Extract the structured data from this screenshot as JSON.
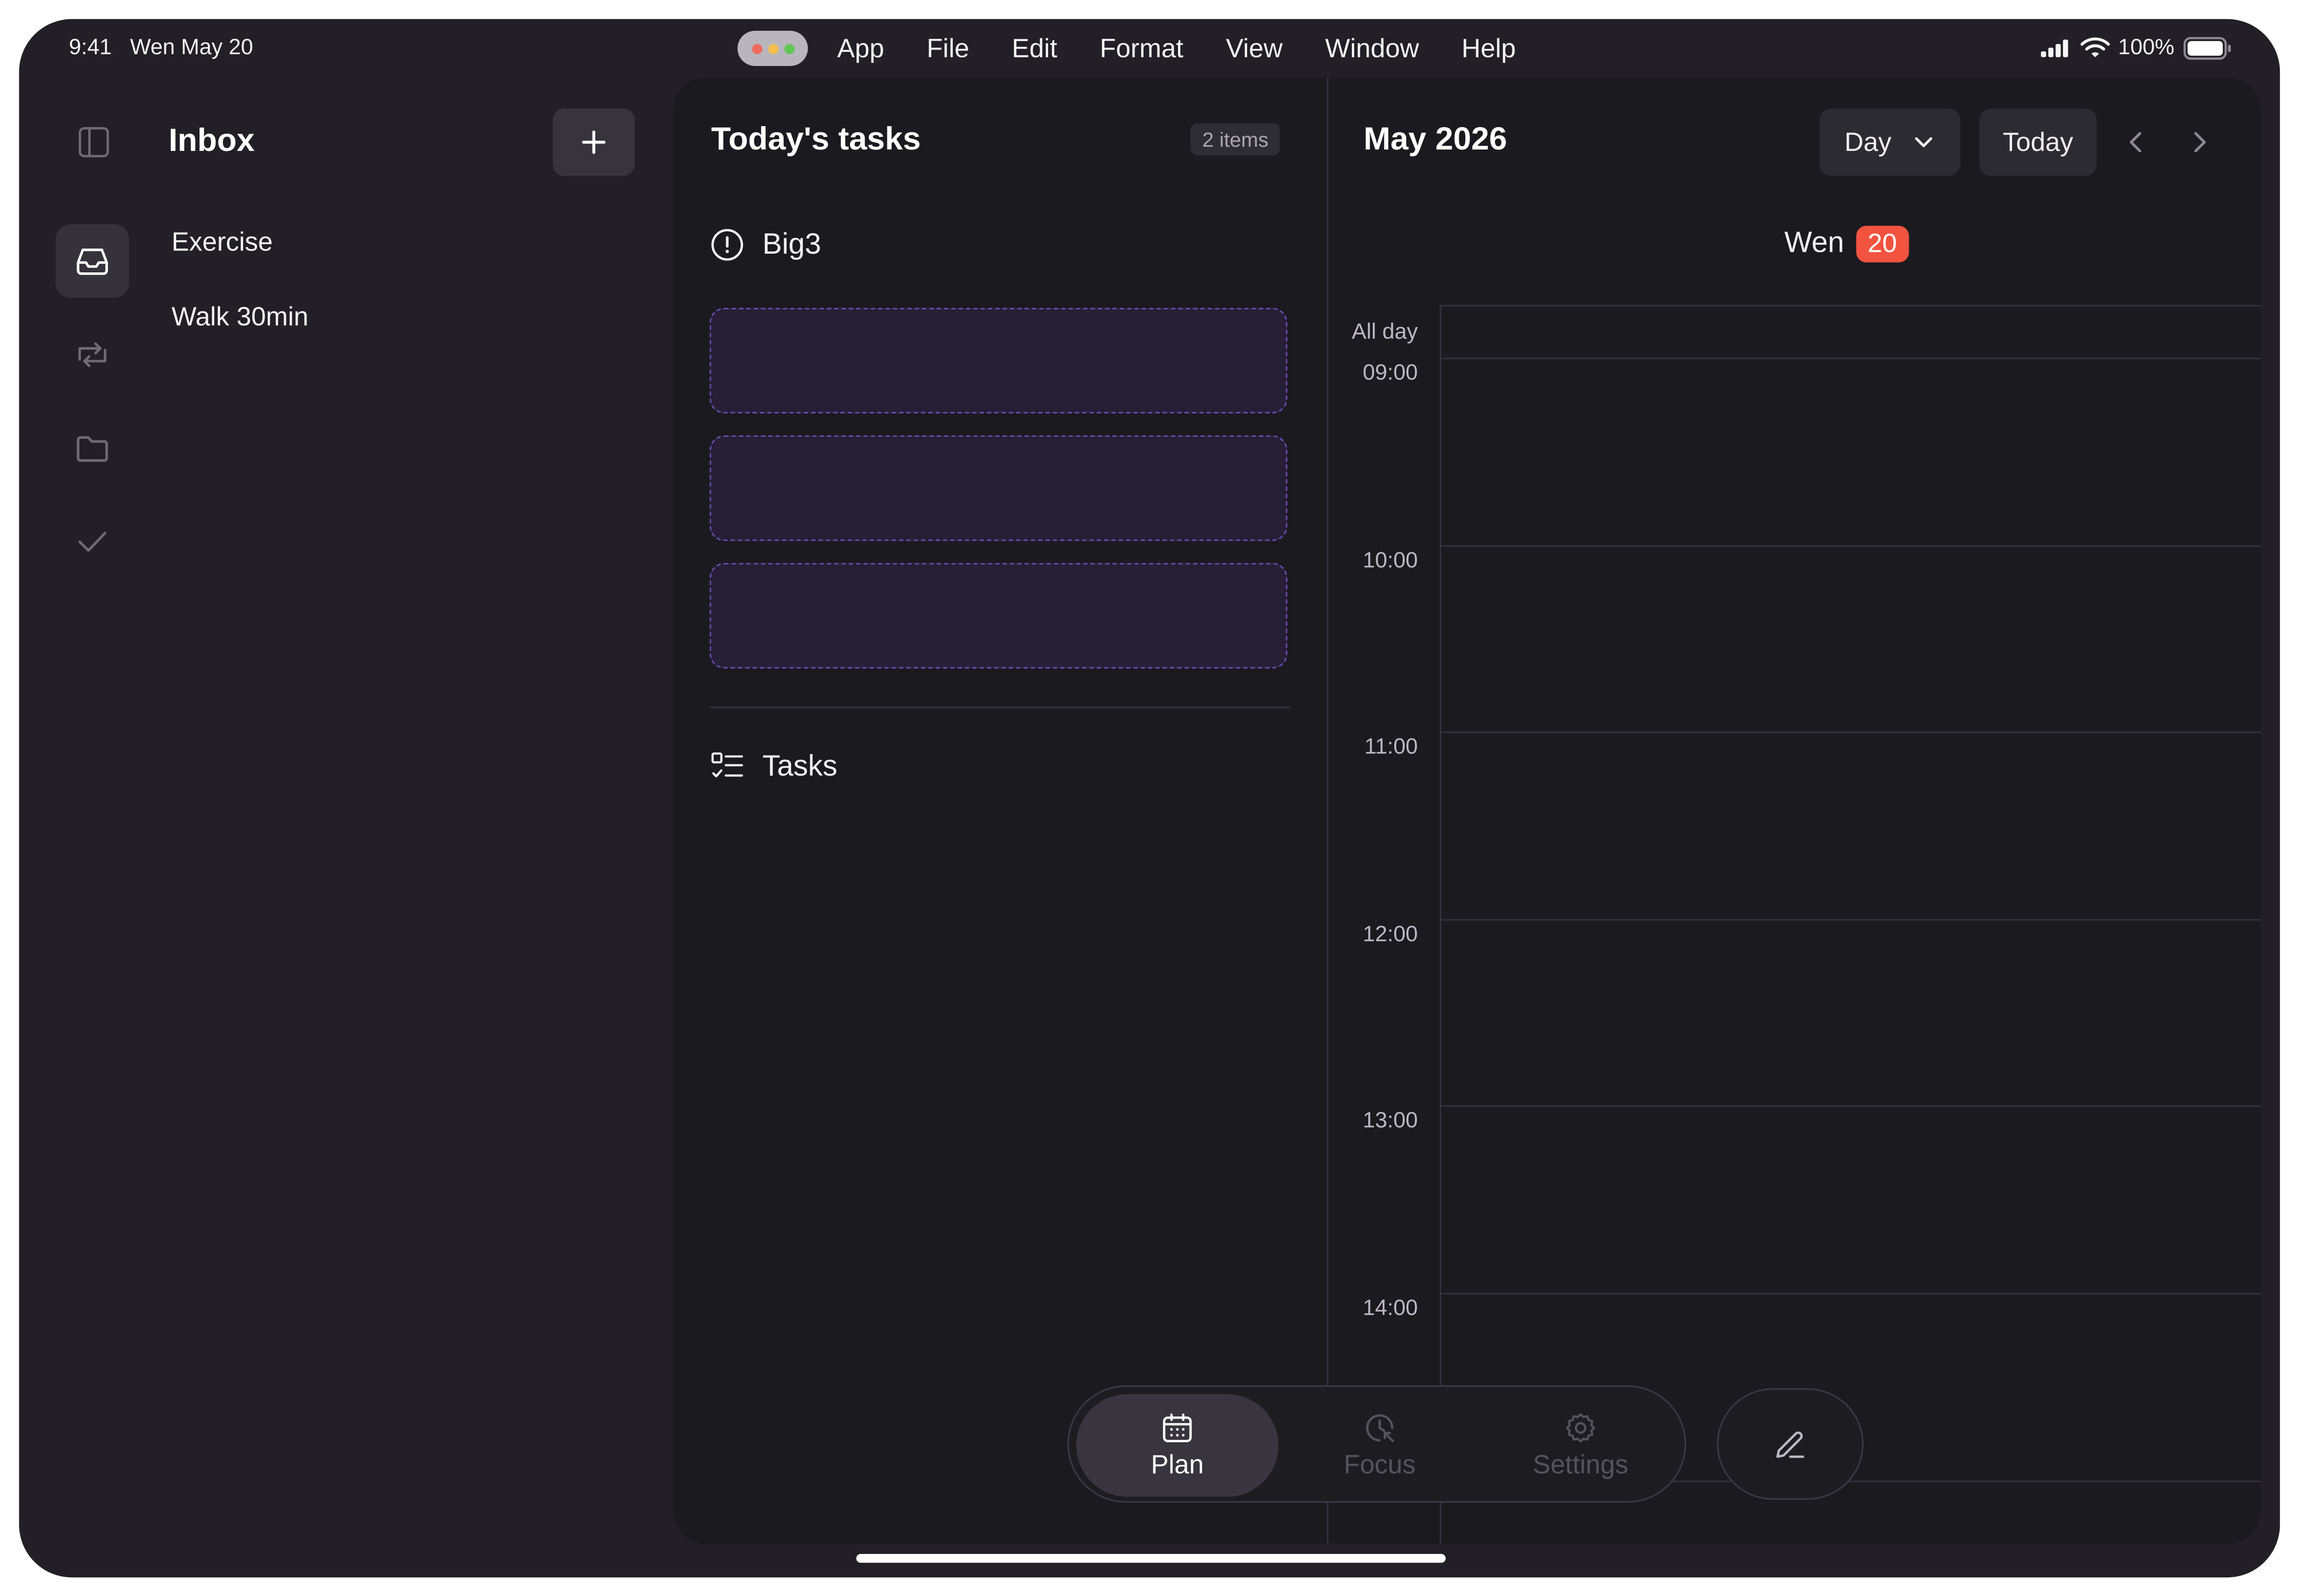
{
  "status_bar": {
    "time": "9:41",
    "date": "Wen May 20",
    "battery": "100%"
  },
  "menubar": {
    "items": [
      "App",
      "File",
      "Edit",
      "Format",
      "View",
      "Window",
      "Help"
    ]
  },
  "sidebar": {
    "title": "Inbox",
    "add_label": "+",
    "items": [
      {
        "label": "Exercise"
      },
      {
        "label": "Walk 30min"
      }
    ]
  },
  "today": {
    "title": "Today's tasks",
    "count_badge": "2 items",
    "big3_label": "Big3",
    "tasks_label": "Tasks"
  },
  "calendar": {
    "title": "May 2026",
    "view_label": "Day",
    "today_label": "Today",
    "day_name": "Wen",
    "day_number": "20",
    "all_day_label": "All day",
    "hours": [
      "09:00",
      "10:00",
      "11:00",
      "12:00",
      "13:00",
      "14:00"
    ]
  },
  "tabbar": {
    "tabs": [
      {
        "label": "Plan",
        "active": true
      },
      {
        "label": "Focus",
        "active": false
      },
      {
        "label": "Settings",
        "active": false
      }
    ]
  },
  "colors": {
    "background": "#222026",
    "panel": "#1b1a1f",
    "accent_purple": "#6a4bb3",
    "date_badge": "#f1533f"
  }
}
